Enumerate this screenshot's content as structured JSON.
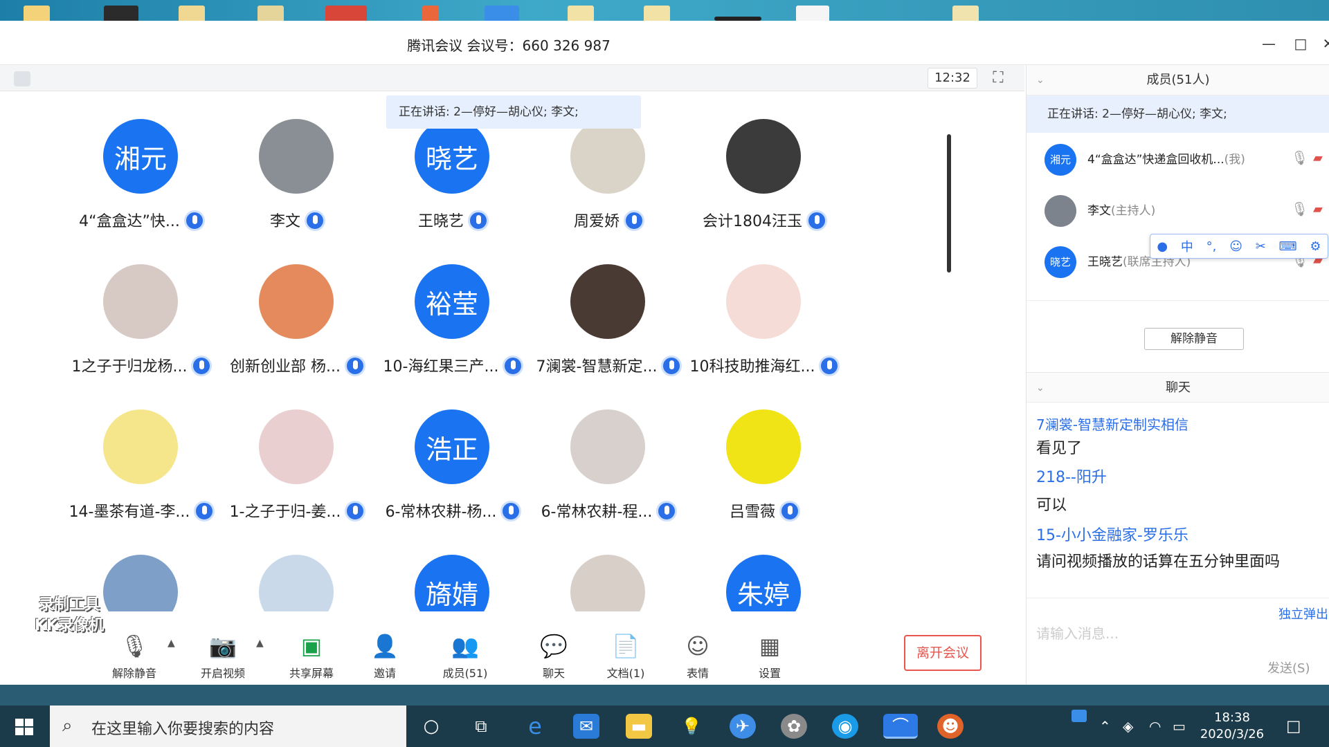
{
  "window": {
    "title": "腾讯会议 会议号：660 326 987"
  },
  "top_strip": {
    "time": "12:32"
  },
  "speaking_banner": "正在讲话: 2—停好—胡心仪; 李文;",
  "participants": [
    {
      "label": "4“盒盒达”快...",
      "avatar_text": "湘元",
      "avatar_color": "#1a73f0"
    },
    {
      "label": "李文",
      "avatar_text": "",
      "avatar_color": "#8a8f96"
    },
    {
      "label": "王晓艺",
      "avatar_text": "晓艺",
      "avatar_color": "#1a73f0"
    },
    {
      "label": "周爱娇",
      "avatar_text": "",
      "avatar_color": "#d9d3c8"
    },
    {
      "label": "会计1804汪玉",
      "avatar_text": "",
      "avatar_color": "#3b3b3b"
    },
    {
      "label": "1之子于归龙杨...",
      "avatar_text": "",
      "avatar_color": "#d7c9c4"
    },
    {
      "label": "创新创业部 杨...",
      "avatar_text": "",
      "avatar_color": "#e58a5c"
    },
    {
      "label": "10-海红果三产...",
      "avatar_text": "裕莹",
      "avatar_color": "#1a73f0"
    },
    {
      "label": "7澜裳-智慧新定...",
      "avatar_text": "",
      "avatar_color": "#4a3a34"
    },
    {
      "label": "10科技助推海红...",
      "avatar_text": "",
      "avatar_color": "#f6dcd6"
    },
    {
      "label": "14-墨茶有道-李...",
      "avatar_text": "",
      "avatar_color": "#f5e68b"
    },
    {
      "label": "1-之子于归-姜...",
      "avatar_text": "",
      "avatar_color": "#e9cfcf"
    },
    {
      "label": "6-常林农耕-杨...",
      "avatar_text": "浩正",
      "avatar_color": "#1a73f0"
    },
    {
      "label": "6-常林农耕-程...",
      "avatar_text": "",
      "avatar_color": "#d8d0cc"
    },
    {
      "label": "吕雪薇",
      "avatar_text": "",
      "avatar_color": "#f0e316"
    },
    {
      "label": "",
      "avatar_text": "",
      "avatar_color": "#7ea0c8"
    },
    {
      "label": "",
      "avatar_text": "",
      "avatar_color": "#c9d9ea"
    },
    {
      "label": "",
      "avatar_text": "旖婧",
      "avatar_color": "#1a73f0"
    },
    {
      "label": "",
      "avatar_text": "",
      "avatar_color": "#d8cfc9"
    },
    {
      "label": "",
      "avatar_text": "朱婷",
      "avatar_color": "#1a73f0"
    }
  ],
  "toolbar": {
    "mute": "解除静音",
    "video": "开启视频",
    "share": "共享屏幕",
    "invite": "邀请",
    "members": "成员(51)",
    "chat": "聊天",
    "docs": "文档(1)",
    "emoji": "表情",
    "settings": "设置",
    "leave": "离开会议"
  },
  "watermark": {
    "line1": "录制工具",
    "line2": "KK录像机"
  },
  "right_panel": {
    "members_header": "成员(51人)",
    "speaking": "正在讲话: 2—停好—胡心仪; 李文;",
    "members": [
      {
        "avatar_text": "湘元",
        "name": "4“盒盒达”快递盒回收机...",
        "role": "(我)"
      },
      {
        "avatar_text": "",
        "name": "李文",
        "role": "(主持人)"
      },
      {
        "avatar_text": "晓艺",
        "name": "王晓艺",
        "role": "(联席主持人)"
      }
    ],
    "ime_items": [
      "中",
      "°,",
      "☺",
      "✂",
      "⌨",
      "⚙"
    ],
    "unmute_button": "解除静音",
    "chat_header": "聊天",
    "chat_lines": [
      {
        "type": "sender",
        "text": "7澜裳-智慧新定制实相信"
      },
      {
        "type": "msg",
        "text": "看见了"
      },
      {
        "type": "sender",
        "text": "218--阳升"
      },
      {
        "type": "msg",
        "text": "可以"
      },
      {
        "type": "sender",
        "text": "15-小小金融家-罗乐乐"
      },
      {
        "type": "msg",
        "text": "请问视频播放的话算在五分钟里面吗"
      }
    ],
    "popout": "独立弹出",
    "input_placeholder": "请输入消息...",
    "send": "发送(S)"
  },
  "taskbar": {
    "search_placeholder": "在这里输入你要搜索的内容",
    "time": "18:38",
    "date": "2020/3/26"
  }
}
